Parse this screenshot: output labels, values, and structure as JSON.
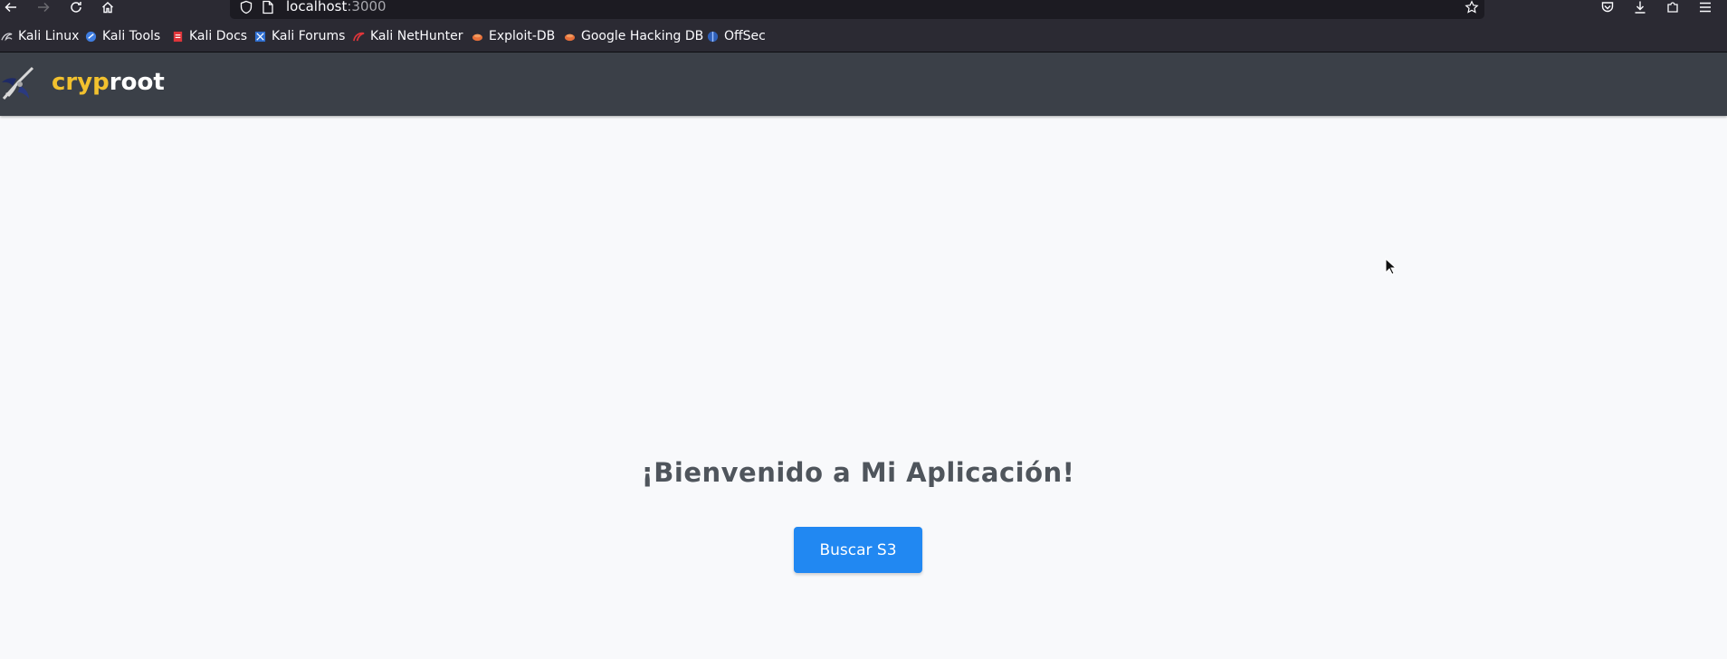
{
  "browser": {
    "url_host": "localhost",
    "url_port": ":3000"
  },
  "bookmarks": [
    {
      "label": "Kali Linux",
      "icon": "kali-dragon-icon"
    },
    {
      "label": "Kali Tools",
      "icon": "kali-tools-icon"
    },
    {
      "label": "Kali Docs",
      "icon": "kali-docs-icon"
    },
    {
      "label": "Kali Forums",
      "icon": "kali-forums-icon"
    },
    {
      "label": "Kali NetHunter",
      "icon": "nethunter-icon"
    },
    {
      "label": "Exploit-DB",
      "icon": "exploit-db-icon"
    },
    {
      "label": "Google Hacking DB",
      "icon": "ghdb-icon"
    },
    {
      "label": "OffSec",
      "icon": "offsec-icon"
    }
  ],
  "header": {
    "brand_part1": "cryp",
    "brand_part2": "root",
    "brand_color": "#f2c12e"
  },
  "main": {
    "title": "¡Bienvenido a Mi Aplicación!",
    "button_label": "Buscar S3",
    "button_color": "#2188f2"
  }
}
